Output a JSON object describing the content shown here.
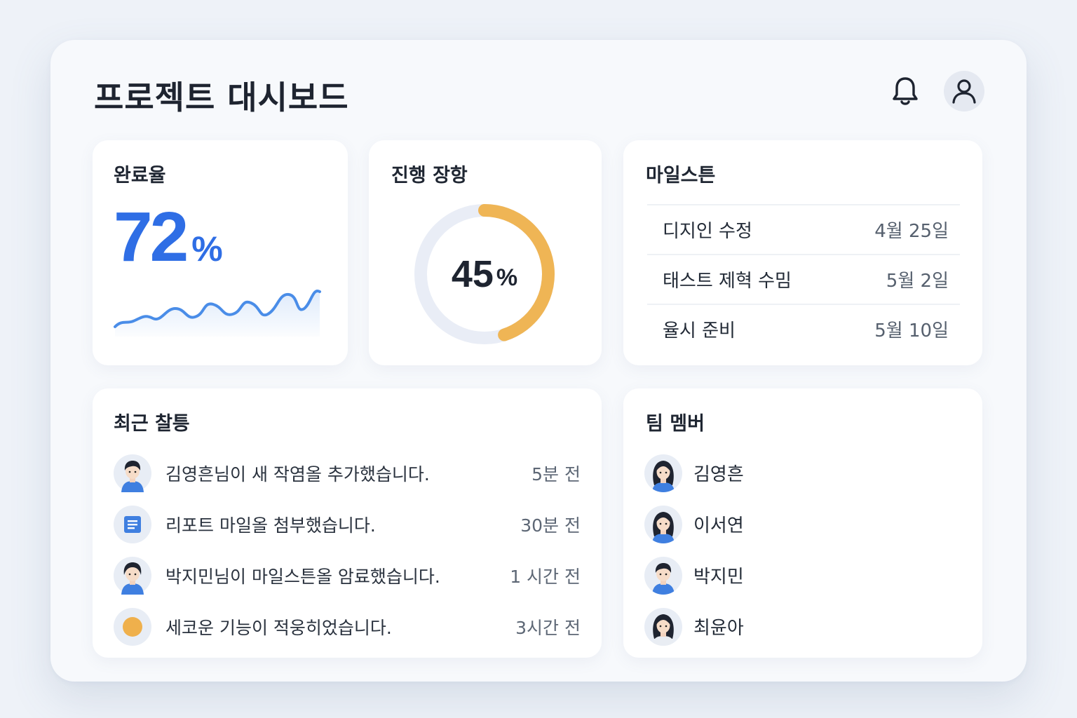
{
  "header": {
    "title": "프로젝트 대시보드",
    "notification_icon": "bell-icon",
    "profile_icon": "user-icon"
  },
  "completion": {
    "title": "완료율",
    "value": "72",
    "unit": "%",
    "trend_icon": "sparkline"
  },
  "progress": {
    "title": "진행 장항",
    "value": "45",
    "unit": "%",
    "fraction": 0.45
  },
  "milestones": {
    "title": "마일스튼",
    "items": [
      {
        "name": "디지인 수정",
        "date": "4월 25일"
      },
      {
        "name": "태스트 제혁 수밈",
        "date": "5월 2일"
      },
      {
        "name": "율시 준비",
        "date": "5월 10일"
      }
    ]
  },
  "activity": {
    "title": "최근 찰틍",
    "items": [
      {
        "text": "김영흔님이 새 작염올 추가했습니다.",
        "time": "5분 전",
        "icon": "avatar-male"
      },
      {
        "text": "리포트 마일올 첨부했습니다.",
        "time": "30분 전",
        "icon": "document-icon"
      },
      {
        "text": "박지민님이 마일스튼올 암료했습니다.",
        "time": "1 시간 전",
        "icon": "avatar-female"
      },
      {
        "text": "세코운 기능이 적웅히었습니다.",
        "time": "3시간 전",
        "icon": "status-dot"
      }
    ]
  },
  "team": {
    "title": "팀 멤버",
    "members": [
      {
        "name": "김영흔",
        "avatar": "avatar-female"
      },
      {
        "name": "이서연",
        "avatar": "avatar-female"
      },
      {
        "name": "박지민",
        "avatar": "avatar-male"
      },
      {
        "name": "최윤아",
        "avatar": "avatar-female"
      }
    ]
  },
  "colors": {
    "accent": "#2f6ee5",
    "progress_arc": "#efb555",
    "progress_track": "#e9edf6",
    "status_dot": "#efb04c"
  }
}
